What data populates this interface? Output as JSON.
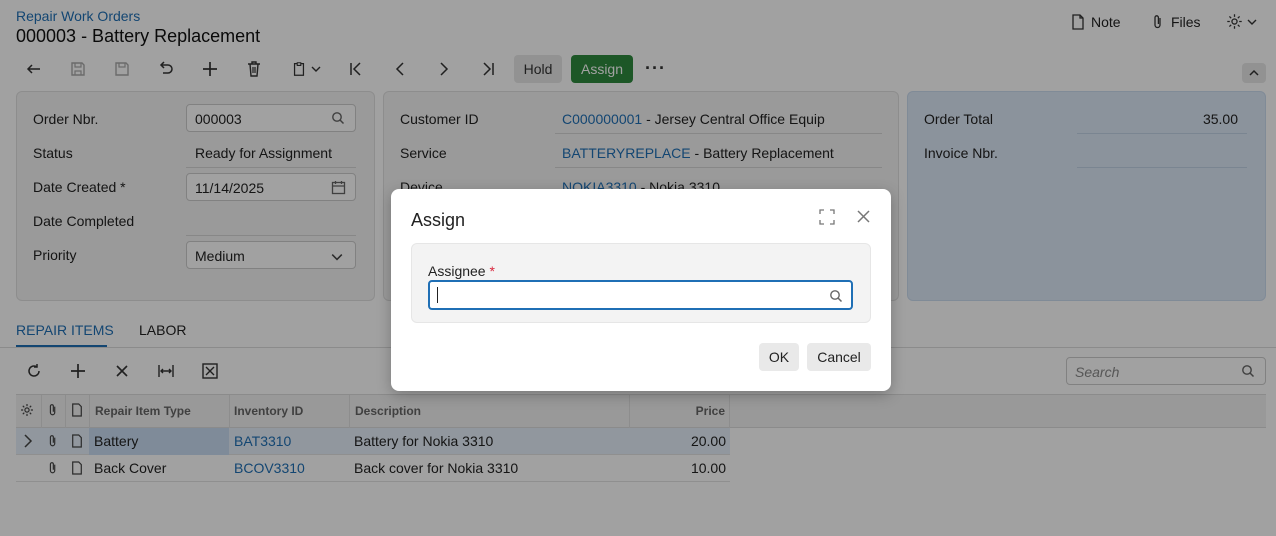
{
  "header": {
    "breadcrumb": "Repair Work Orders",
    "title": "000003 - Battery Replacement",
    "note_label": "Note",
    "files_label": "Files"
  },
  "toolbar": {
    "hold_label": "Hold",
    "assign_label": "Assign",
    "more_label": "···"
  },
  "summary_left": {
    "order_nbr_label": "Order Nbr.",
    "order_nbr_value": "000003",
    "status_label": "Status",
    "status_value": "Ready for Assignment",
    "date_created_label": "Date Created",
    "date_created_value": "11/14/2025",
    "date_completed_label": "Date Completed",
    "priority_label": "Priority",
    "priority_value": "Medium",
    "required_mark": "*"
  },
  "summary_mid": {
    "customer_label": "Customer ID",
    "customer_id": "C000000001",
    "customer_name": " - Jersey Central Office Equip",
    "service_label": "Service",
    "service_id": "BATTERYREPLACE",
    "service_name": " - Battery Replacement",
    "device_label": "Device",
    "device_id": "NOKIA3310",
    "device_name": " - Nokia 3310"
  },
  "summary_right": {
    "order_total_label": "Order Total",
    "order_total_value": "35.00",
    "invoice_label": "Invoice Nbr."
  },
  "tabs": [
    {
      "label": "REPAIR ITEMS",
      "active": true
    },
    {
      "label": "LABOR",
      "active": false
    }
  ],
  "grid": {
    "search_placeholder": "Search",
    "columns": [
      "Repair Item Type",
      "Inventory ID",
      "Description",
      "Price"
    ],
    "rows": [
      {
        "type": "Battery",
        "inventory_id": "BAT3310",
        "description": "Battery for Nokia 3310",
        "price": "20.00"
      },
      {
        "type": "Back Cover",
        "inventory_id": "BCOV3310",
        "description": "Back cover for Nokia 3310",
        "price": "10.00"
      }
    ]
  },
  "dialog": {
    "title": "Assign",
    "assignee_label": "Assignee",
    "required_mark": "*",
    "assignee_value": "",
    "ok_label": "OK",
    "cancel_label": "Cancel"
  },
  "colors": {
    "accent": "#1f6fb5",
    "assign_button": "#2e8b3e",
    "right_panel": "#dde9f7",
    "required": "#d9263c"
  }
}
